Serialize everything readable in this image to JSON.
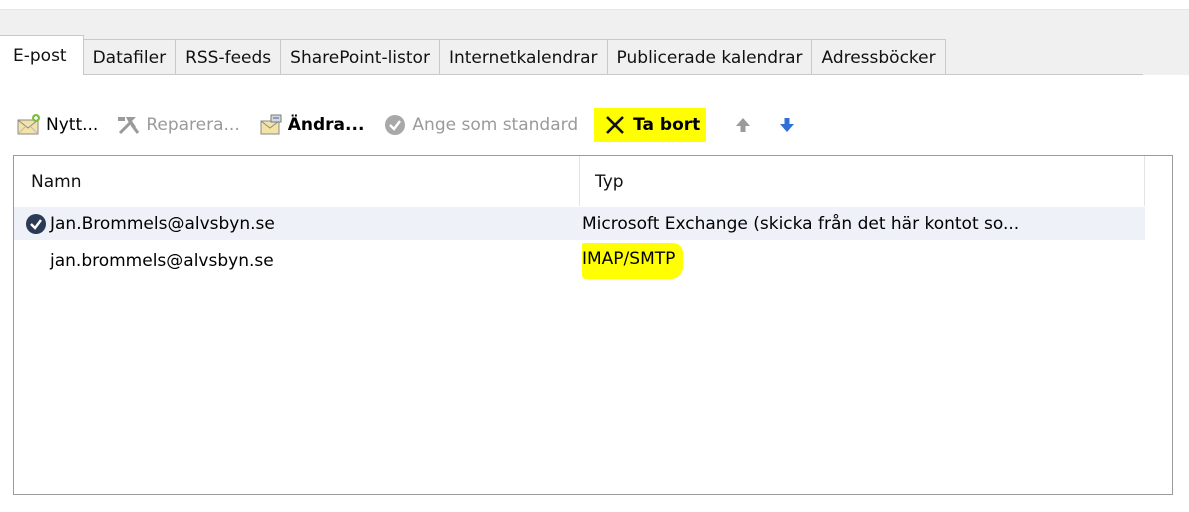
{
  "tabs": [
    {
      "label": "E-post",
      "active": true
    },
    {
      "label": "Datafiler",
      "active": false
    },
    {
      "label": "RSS-feeds",
      "active": false
    },
    {
      "label": "SharePoint-listor",
      "active": false
    },
    {
      "label": "Internetkalendrar",
      "active": false
    },
    {
      "label": "Publicerade kalendrar",
      "active": false
    },
    {
      "label": "Adressböcker",
      "active": false
    }
  ],
  "toolbar": {
    "new_label": "Nytt...",
    "repair_label": "Reparera...",
    "change_label": "Ändra...",
    "set_default_label": "Ange som standard",
    "delete_label": "Ta bort"
  },
  "list": {
    "col_name": "Namn",
    "col_type": "Typ",
    "rows": [
      {
        "name": "Jan.Brommels@alvsbyn.se",
        "type": "Microsoft Exchange (skicka från det här kontot so...",
        "default": true
      },
      {
        "name": "jan.brommels@alvsbyn.se",
        "type": "IMAP/SMTP",
        "default": false
      }
    ]
  },
  "colors": {
    "highlight": "#ffff00",
    "arrow_up": "#9a9a9a",
    "arrow_down": "#2f6fd6"
  },
  "icons": [
    "envelope-new-icon",
    "tools-repair-icon",
    "change-account-icon",
    "checkmark-circle-icon",
    "delete-x-icon",
    "arrow-up-icon",
    "arrow-down-icon",
    "default-account-check-icon"
  ]
}
